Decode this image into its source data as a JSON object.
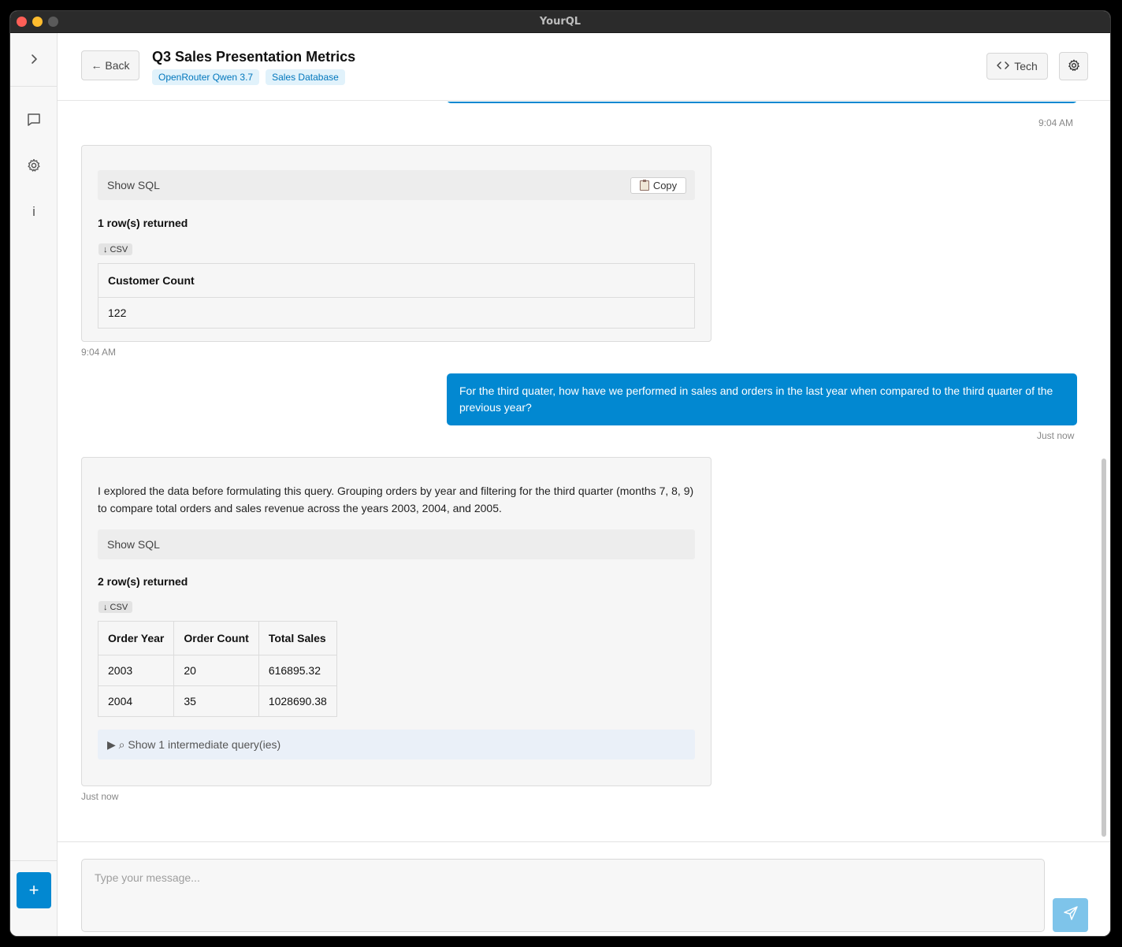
{
  "window": {
    "title": "YourQL"
  },
  "header": {
    "back_label": "← Back",
    "title": "Q3 Sales Presentation Metrics",
    "tags": [
      "OpenRouter Qwen 3.7",
      "Sales Database"
    ],
    "tech_label": "Tech"
  },
  "messages": {
    "prev_user_time": "9:04 AM",
    "result1": {
      "sql_label": "Show SQL",
      "copy_label": "Copy",
      "rows_label": "1 row(s) returned",
      "csv_label": "↓ CSV",
      "columns": [
        "Customer Count"
      ],
      "rows": [
        [
          "122"
        ]
      ],
      "time": "9:04 AM"
    },
    "user2": {
      "text": "For the third quater, how have we performed in sales and orders in the last year when compared to the third quarter of the previous year?",
      "time": "Just now"
    },
    "result2": {
      "explanation": "I explored the data before formulating this query. Grouping orders by year and filtering for the third quarter (months 7, 8, 9) to compare total orders and sales revenue across the years 2003, 2004, and 2005.",
      "sql_label": "Show SQL",
      "rows_label": "2 row(s) returned",
      "csv_label": "↓ CSV",
      "columns": [
        "Order Year",
        "Order Count",
        "Total Sales"
      ],
      "rows": [
        [
          "2003",
          "20",
          "616895.32"
        ],
        [
          "2004",
          "35",
          "1028690.38"
        ]
      ],
      "intermediate_label": "▶ ⌕ Show 1 intermediate query(ies)",
      "time": "Just now"
    }
  },
  "composer": {
    "placeholder": "Type your message..."
  },
  "colors": {
    "accent": "#0288d1",
    "send_disabled": "#7ec4ea",
    "tag_bg": "#e1f2fb"
  }
}
